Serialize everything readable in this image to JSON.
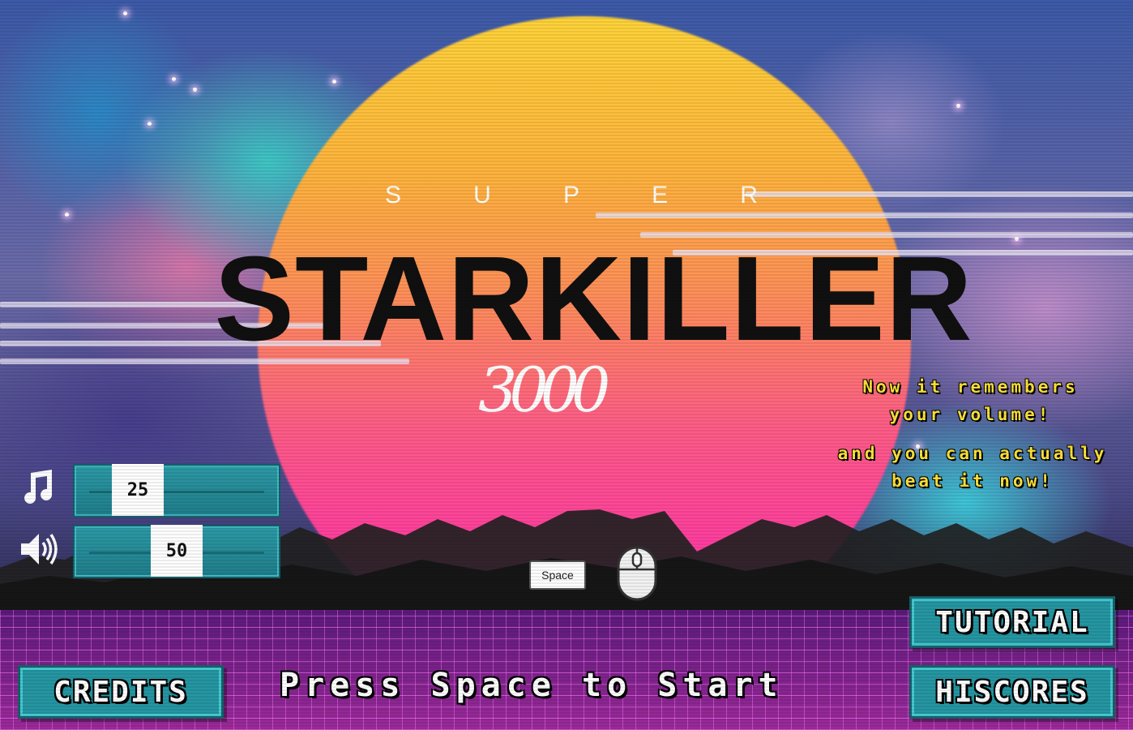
{
  "title": {
    "super": [
      "S",
      "U",
      "P",
      "E",
      "R"
    ],
    "main": "STARKILLER",
    "year": "3000"
  },
  "notes": {
    "line1": "Now it remembers",
    "line2": "your volume!",
    "line3": "and you can actually",
    "line4": "beat it now!"
  },
  "volume": {
    "music_icon": "music-note-icon",
    "sound_icon": "speaker-icon",
    "music_value": "25",
    "sound_value": "50"
  },
  "controls": {
    "space_key": "Space",
    "mouse_icon": "mouse-icon",
    "press_start": "Press Space to Start"
  },
  "buttons": {
    "credits": "CREDITS",
    "tutorial": "TUTORIAL",
    "hiscores": "HISCORES"
  },
  "colors": {
    "accent_teal": "#2596a2",
    "note_yellow": "#ffe43a",
    "floor_magenta": "#8a1f8a"
  }
}
